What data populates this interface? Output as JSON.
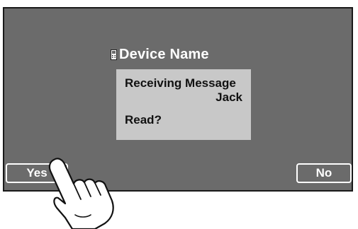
{
  "header": {
    "device_name": "Device Name",
    "device_icon": "phone-icon"
  },
  "message_box": {
    "line1": "Receiving Message",
    "sender": "Jack",
    "question": "Read?"
  },
  "buttons": {
    "yes_label": "Yes",
    "no_label": "No"
  },
  "colors": {
    "screen_background": "#6b6b6b",
    "message_box_background": "#c8c8c8",
    "text_light": "#ffffff"
  },
  "illustration": {
    "pointer": "hand-pointer-icon"
  }
}
